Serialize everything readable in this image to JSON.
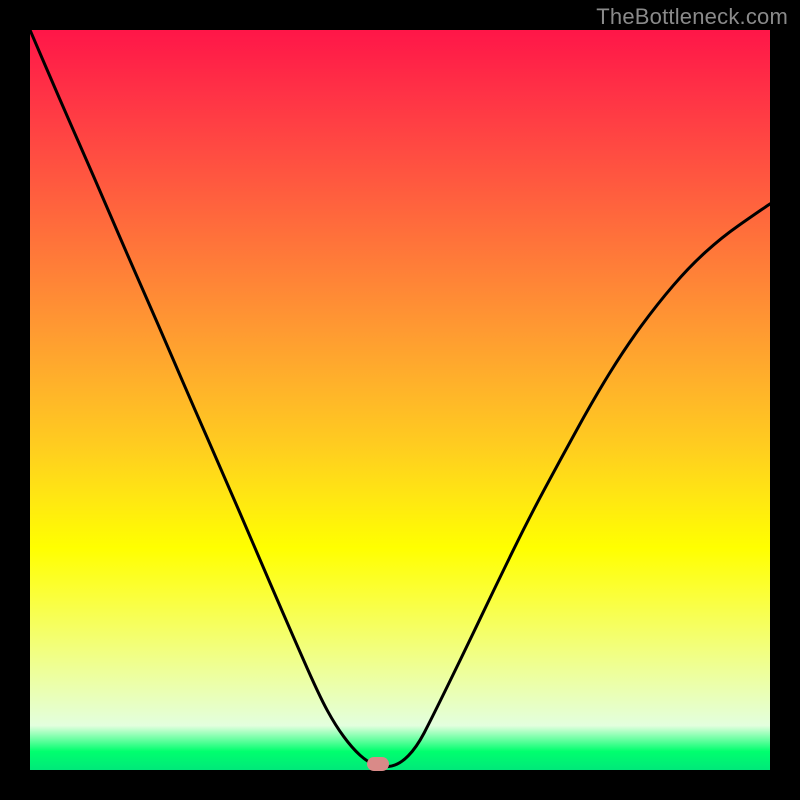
{
  "watermark": "TheBottleneck.com",
  "marker": {
    "x_frac": 0.47,
    "y_frac": 0.992,
    "color": "#d98a88"
  },
  "chart_data": {
    "type": "line",
    "title": "",
    "xlabel": "",
    "ylabel": "",
    "xlim": [
      0,
      1
    ],
    "ylim": [
      0,
      1
    ],
    "grid": false,
    "legend": false,
    "annotations": [
      "TheBottleneck.com"
    ],
    "series": [
      {
        "name": "bottleneck-curve",
        "x": [
          0.0,
          0.043,
          0.087,
          0.13,
          0.174,
          0.217,
          0.261,
          0.304,
          0.347,
          0.391,
          0.413,
          0.435,
          0.457,
          0.478,
          0.5,
          0.522,
          0.543,
          0.587,
          0.63,
          0.674,
          0.717,
          0.761,
          0.804,
          0.848,
          0.891,
          0.935,
          0.978,
          1.0
        ],
        "y": [
          1.0,
          0.9,
          0.8,
          0.7,
          0.6,
          0.5,
          0.4,
          0.3,
          0.2,
          0.1,
          0.06,
          0.03,
          0.01,
          0.003,
          0.008,
          0.03,
          0.07,
          0.16,
          0.25,
          0.34,
          0.42,
          0.5,
          0.57,
          0.63,
          0.68,
          0.72,
          0.75,
          0.765
        ]
      }
    ],
    "background_gradient": {
      "direction": "vertical",
      "stops": [
        {
          "pos": 0.0,
          "color": "#ff1648"
        },
        {
          "pos": 0.35,
          "color": "#ff8a35"
        },
        {
          "pos": 0.7,
          "color": "#ffff00"
        },
        {
          "pos": 0.94,
          "color": "#e3ffde"
        },
        {
          "pos": 1.0,
          "color": "#00e87a"
        }
      ]
    },
    "marker": {
      "x": 0.47,
      "y": 0.008
    }
  }
}
